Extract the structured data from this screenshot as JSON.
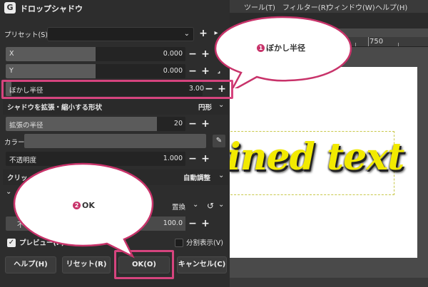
{
  "background_window": {
    "menu": [
      "ツール(T)",
      "フィルター(R)",
      "ウィンドウ(W)",
      "ヘルプ(H)"
    ],
    "ruler_label": "750",
    "canvas_text": "ined text"
  },
  "dialog": {
    "app_icon_letter": "G",
    "title": "ドロップシャドウ",
    "preset_label": "プリセット(S):",
    "preset_value": "",
    "x": {
      "label": "X",
      "value": "0.000",
      "fill": 0.5
    },
    "y": {
      "label": "Y",
      "value": "0.000",
      "fill": 0.5
    },
    "blur_radius": {
      "label": "ぼかし半径",
      "value": "3.00"
    },
    "grow_shape": {
      "label": "シャドウを拡張・縮小する形状",
      "value": "円形"
    },
    "grow_radius": {
      "label": "拡張の半径",
      "value": "20",
      "fill": 0.84
    },
    "color_label": "カラー",
    "color_value": "#555555",
    "opacity": {
      "label": "不透明度",
      "value": "1.000"
    },
    "clipping": {
      "label": "クリッ",
      "value": "自動調整"
    },
    "blend_mode": "置換",
    "opacity2": {
      "label": "不",
      "value": "100.0"
    },
    "preview_label": "プレビュー(P)",
    "preview_checked": true,
    "split_label": "分割表示(V)",
    "split_checked": false,
    "buttons": {
      "help": "ヘルプ(H)",
      "reset": "リセット(R)",
      "ok": "OK(O)",
      "cancel": "キャンセル(C)"
    }
  },
  "callouts": {
    "one": {
      "badge": "1",
      "text": "ぼかし半径"
    },
    "two": {
      "badge": "2",
      "text": "OK"
    }
  },
  "colors": {
    "highlight": "#d6447e",
    "canvas_text": "#f2ea00",
    "badge": "#c8336a"
  }
}
